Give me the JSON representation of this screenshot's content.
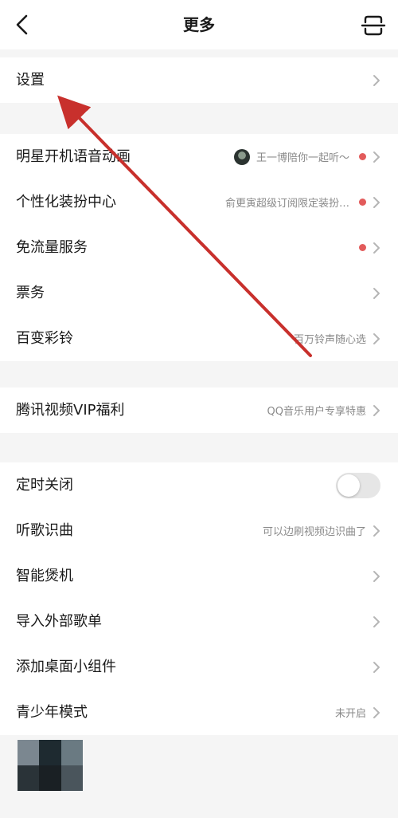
{
  "header": {
    "title": "更多"
  },
  "sections": [
    [
      {
        "label": "设置",
        "hint": "",
        "dot": false,
        "chevron": true
      }
    ],
    [
      {
        "label": "明星开机语音动画",
        "hint": "王一博陪你一起听～",
        "avatar": true,
        "dot": true,
        "chevron": true
      },
      {
        "label": "个性化装扮中心",
        "hint": "俞更寅超级订阅限定装扮…",
        "dot": true,
        "chevron": true
      },
      {
        "label": "免流量服务",
        "hint": "",
        "dot": true,
        "chevron": true
      },
      {
        "label": "票务",
        "hint": "",
        "dot": false,
        "chevron": true
      },
      {
        "label": "百变彩铃",
        "hint": "百万铃声随心选",
        "dot": false,
        "chevron": true
      }
    ],
    [
      {
        "label": "腾讯视频VIP福利",
        "hint": "QQ音乐用户专享特惠",
        "dot": false,
        "chevron": true
      }
    ],
    [
      {
        "label": "定时关闭",
        "toggle": true,
        "toggle_on": false
      },
      {
        "label": "听歌识曲",
        "hint": "可以边刷视频边识曲了",
        "dot": false,
        "chevron": true
      },
      {
        "label": "智能煲机",
        "hint": "",
        "dot": false,
        "chevron": true
      },
      {
        "label": "导入外部歌单",
        "hint": "",
        "dot": false,
        "chevron": true
      },
      {
        "label": "添加桌面小组件",
        "hint": "",
        "dot": false,
        "chevron": true
      },
      {
        "label": "青少年模式",
        "hint": "未开启",
        "dot": false,
        "chevron": true
      }
    ]
  ],
  "colors": {
    "annotation_arrow": "#c8302c",
    "badge_dot": "#e25b5b"
  },
  "icons": {
    "back": "back-arrow-icon",
    "scan": "scan-icon",
    "chevron": "chevron-right-icon"
  }
}
